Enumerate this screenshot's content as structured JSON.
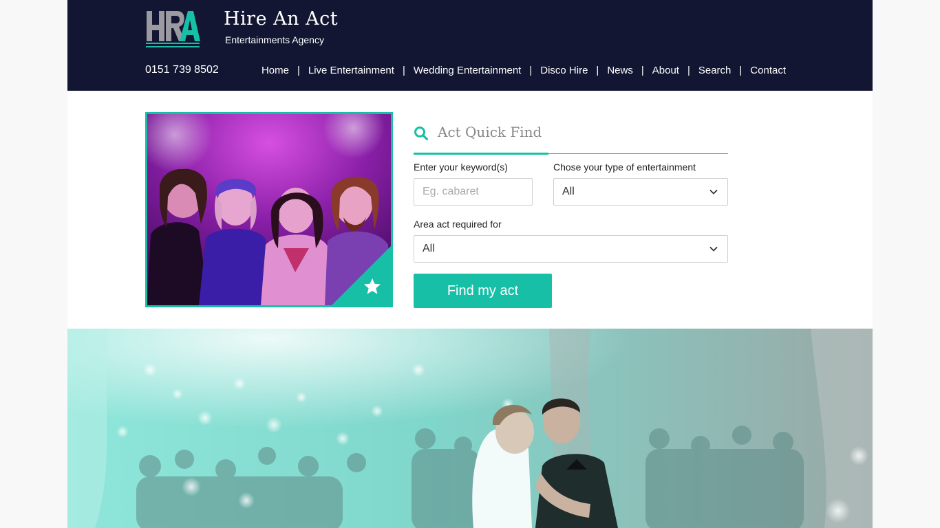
{
  "brand": {
    "title": "Hire An Act",
    "subtitle": "Entertainments Agency",
    "logo_icon": "hra-logo-icon"
  },
  "header": {
    "phone": "0151 739 8502",
    "nav": [
      {
        "label": "Home"
      },
      {
        "label": "Live Entertainment"
      },
      {
        "label": "Wedding Entertainment"
      },
      {
        "label": "Disco Hire"
      },
      {
        "label": "News"
      },
      {
        "label": "About"
      },
      {
        "label": "Search"
      },
      {
        "label": "Contact"
      }
    ],
    "nav_separator": "|"
  },
  "quick_find": {
    "title": "Act Quick Find",
    "search_icon": "search-icon",
    "keyword_label": "Enter your keyword(s)",
    "keyword_placeholder": "Eg. cabaret",
    "keyword_value": "",
    "type_label": "Chose your type of entertainment",
    "type_value": "All",
    "area_label": "Area act required for",
    "area_value": "All",
    "submit_label": "Find my act"
  },
  "featured": {
    "star_icon": "star-icon"
  },
  "colors": {
    "accent": "#16bfa6",
    "header_bg": "#121632",
    "nav_text": "#ffffff"
  }
}
